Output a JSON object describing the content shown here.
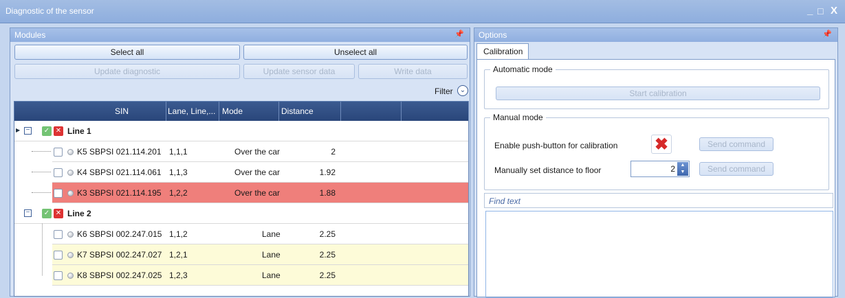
{
  "window": {
    "title": "Diagnostic of the sensor",
    "minimize": "_",
    "maximize": "□",
    "close": "X"
  },
  "modules": {
    "title": "Modules",
    "pin": "ᵖ",
    "select_all": "Select all",
    "unselect_all": "Unselect all",
    "update_diagnostic": "Update diagnostic",
    "update_sensor_data": "Update sensor data",
    "write_data": "Write data",
    "filter": "Filter",
    "columns": [
      "SIN",
      "Lane, Line,...",
      "Mode",
      "Distance"
    ],
    "groups": [
      {
        "label": "Line 1",
        "rows": [
          {
            "sin": "K5 SBPSI 021.114.201",
            "pos": "1,1,1",
            "mode": "Over the car",
            "distance": "2",
            "state": "normal"
          },
          {
            "sin": "K4 SBPSI 021.114.061",
            "pos": "1,1,3",
            "mode": "Over the car",
            "distance": "1.92",
            "state": "normal"
          },
          {
            "sin": "K3 SBPSI 021.114.195",
            "pos": "1,2,2",
            "mode": "Over the car",
            "distance": "1.88",
            "state": "error"
          }
        ]
      },
      {
        "label": "Line 2",
        "rows": [
          {
            "sin": "K6 SBPSI 002.247.015",
            "pos": "1,1,2",
            "mode": "Lane",
            "distance": "2.25",
            "state": "normal"
          },
          {
            "sin": "K7 SBPSI 002.247.027",
            "pos": "1,2,1",
            "mode": "Lane",
            "distance": "2.25",
            "state": "warning"
          },
          {
            "sin": "K8 SBPSI 002.247.025",
            "pos": "1,2,3",
            "mode": "Lane",
            "distance": "2.25",
            "state": "warning"
          }
        ]
      }
    ]
  },
  "options": {
    "title": "Options",
    "pin": "ᵖ",
    "tab": "Calibration",
    "automatic_mode": "Automatic mode",
    "start_calibration": "Start calibration",
    "manual_mode": "Manual mode",
    "enable_push_button": "Enable push-button for calibration",
    "send_command": "Send command",
    "manual_distance": "Manually set distance to floor",
    "distance_value": "2",
    "find_text": "Find text"
  },
  "colors": {
    "error_row": "#ef7f7b",
    "warning_row": "#fdfbd8",
    "header": "#2f4f86"
  }
}
